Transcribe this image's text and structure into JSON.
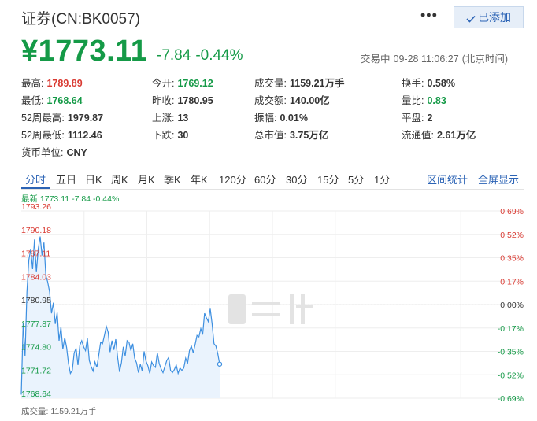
{
  "header": {
    "title": "证券(CN:BK0057)",
    "more_label": "•••",
    "added_label": "已添加"
  },
  "quote": {
    "price": "¥1773.11",
    "change": "-7.84",
    "change_pct": "-0.44%",
    "status": "交易中",
    "time": "09-28 11:06:27",
    "timezone": "(北京时间)"
  },
  "stats": [
    [
      {
        "label": "最高:",
        "value": "1789.89",
        "color": "#d93a32"
      },
      {
        "label": "今开:",
        "value": "1769.12",
        "color": "#159a47"
      },
      {
        "label": "成交量:",
        "value": "1159.21万手",
        "color": "#333333"
      },
      {
        "label": "换手:",
        "value": "0.58%",
        "color": "#333333"
      }
    ],
    [
      {
        "label": "最低:",
        "value": "1768.64",
        "color": "#159a47"
      },
      {
        "label": "昨收:",
        "value": "1780.95",
        "color": "#333333"
      },
      {
        "label": "成交额:",
        "value": "140.00亿",
        "color": "#333333"
      },
      {
        "label": "量比:",
        "value": "0.83",
        "color": "#159a47"
      }
    ],
    [
      {
        "label": "52周最高:",
        "value": "1979.87",
        "color": "#333333"
      },
      {
        "label": "上涨:",
        "value": "13",
        "color": "#333333"
      },
      {
        "label": "振幅:",
        "value": "0.01%",
        "color": "#333333"
      },
      {
        "label": "平盘:",
        "value": "2",
        "color": "#333333"
      }
    ],
    [
      {
        "label": "52周最低:",
        "value": "1112.46",
        "color": "#333333"
      },
      {
        "label": "下跌:",
        "value": "30",
        "color": "#333333"
      },
      {
        "label": "总市值:",
        "value": "3.75万亿",
        "color": "#333333"
      },
      {
        "label": "流通值:",
        "value": "2.61万亿",
        "color": "#333333"
      }
    ],
    [
      {
        "label": "货币单位:",
        "value": "CNY",
        "color": "#333333"
      }
    ]
  ],
  "tabs": [
    "分时",
    "五日",
    "日K",
    "周K",
    "月K",
    "季K",
    "年K",
    "120分",
    "60分",
    "30分",
    "15分",
    "5分",
    "1分"
  ],
  "active_tab": "分时",
  "tab_links": [
    "区间统计",
    "全屏显示"
  ],
  "latest": {
    "label": "最新:1773.11",
    "change": "-7.84",
    "change_pct": "-0.44%"
  },
  "volume_label": "成交量: 1159.21万手",
  "colors": {
    "up": "#d93a32",
    "down": "#159a47",
    "accent": "#2b63b5",
    "line": "#3d8fe0",
    "fill": "#eaf3fd"
  },
  "chart_data": {
    "type": "area",
    "y_ticks_left": [
      "1793.26",
      "1790.18",
      "1787.11",
      "1784.03",
      "1780.95",
      "1777.87",
      "1774.80",
      "1771.72",
      "1768.64"
    ],
    "y_ticks_right": [
      "0.69%",
      "0.52%",
      "0.35%",
      "0.17%",
      "0.00%",
      "-0.17%",
      "-0.35%",
      "-0.52%",
      "-0.69%"
    ],
    "ylim": [
      1768.64,
      1793.26
    ],
    "baseline": 1780.95,
    "session_minutes": 240,
    "y": [
      1769.12,
      1778.5,
      1774.2,
      1782.6,
      1786.8,
      1788.2,
      1785.6,
      1789.5,
      1785.2,
      1788.3,
      1789.89,
      1787.4,
      1789.1,
      1784.8,
      1783.9,
      1782.6,
      1779.8,
      1781.2,
      1778.4,
      1779.9,
      1776.2,
      1778.0,
      1775.1,
      1776.6,
      1775.3,
      1773.2,
      1771.9,
      1772.3,
      1774.6,
      1775.2,
      1773.0,
      1775.6,
      1776.2,
      1775.4,
      1774.9,
      1776.5,
      1773.6,
      1772.8,
      1772.2,
      1773.4,
      1772.7,
      1774.3,
      1776.0,
      1775.8,
      1776.9,
      1778.1,
      1777.3,
      1774.7,
      1776.2,
      1775.0,
      1776.4,
      1774.0,
      1772.1,
      1773.3,
      1775.4,
      1774.2,
      1776.2,
      1776.0,
      1774.9,
      1775.8,
      1773.9,
      1773.3,
      1772.0,
      1773.1,
      1772.2,
      1774.8,
      1773.5,
      1772.9,
      1771.9,
      1773.4,
      1772.9,
      1772.7,
      1774.6,
      1773.2,
      1772.5,
      1772.0,
      1772.8,
      1773.6,
      1774.0,
      1772.3,
      1772.0,
      1772.4,
      1773.0,
      1771.9,
      1772.6,
      1772.3,
      1772.6,
      1773.9,
      1773.2,
      1774.9,
      1775.5,
      1774.6,
      1775.7,
      1776.9,
      1776.7,
      1777.8,
      1777.0,
      1779.8,
      1779.2,
      1778.7,
      1780.4,
      1778.4,
      1775.8,
      1775.5,
      1774.5,
      1773.11
    ]
  }
}
